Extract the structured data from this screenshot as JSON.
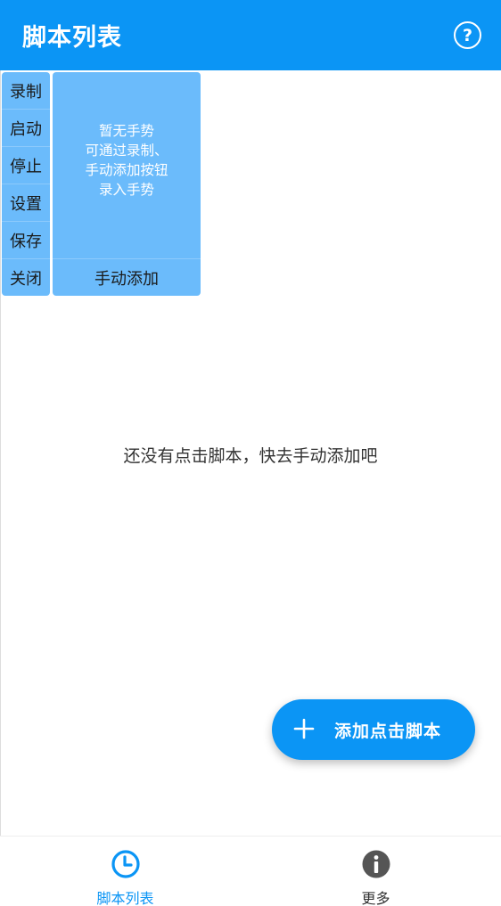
{
  "app_bar": {
    "title": "脚本列表",
    "help_symbol": "?"
  },
  "float_menu": {
    "items": [
      {
        "label": "录制"
      },
      {
        "label": "启动"
      },
      {
        "label": "停止"
      },
      {
        "label": "设置"
      },
      {
        "label": "保存"
      },
      {
        "label": "关闭"
      }
    ]
  },
  "gesture_panel": {
    "empty_lines": [
      "暂无手势",
      "可通过录制、",
      "手动添加按钮",
      "录入手势"
    ],
    "add_label": "手动添加"
  },
  "main": {
    "empty_message": "还没有点击脚本，快去手动添加吧"
  },
  "fab": {
    "icon": "plus-icon",
    "label": "添加点击脚本"
  },
  "bottom_nav": {
    "items": [
      {
        "label": "脚本列表",
        "icon": "clock-icon",
        "active": true
      },
      {
        "label": "更多",
        "icon": "info-icon",
        "active": false
      }
    ]
  },
  "colors": {
    "primary": "#0b95f5",
    "panel": "#6bbbfb",
    "inactive_icon": "#555555"
  }
}
